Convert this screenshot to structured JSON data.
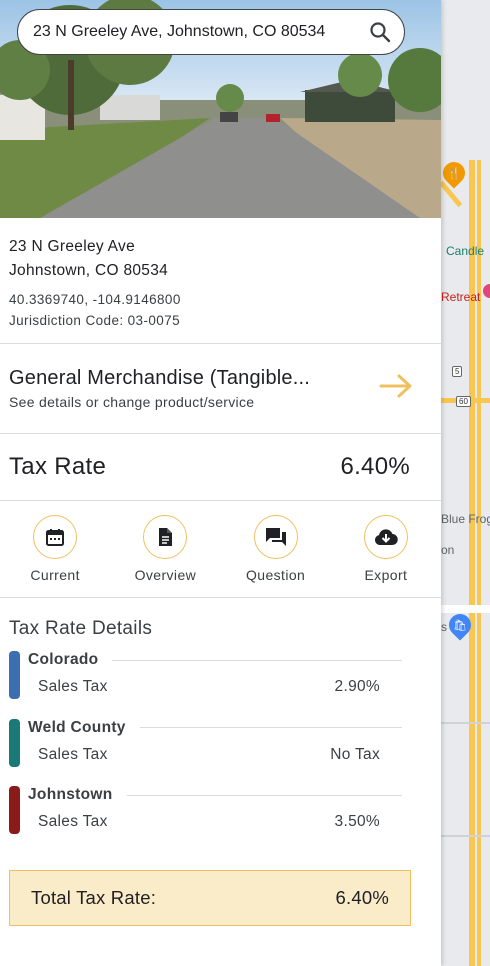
{
  "search": {
    "value": "23 N Greeley Ave, Johnstown, CO 80534",
    "icon": "search-icon"
  },
  "location": {
    "street": "23 N Greeley Ave",
    "city_line": "Johnstown, CO 80534",
    "coordinates": "40.3369740, -104.9146800",
    "jurisdiction": "Jurisdiction Code: 03-0075"
  },
  "product": {
    "title": "General Merchandise (Tangible...",
    "subtitle": "See details or change product/service",
    "icon": "arrow-right-icon"
  },
  "rate": {
    "label": "Tax Rate",
    "value": "6.40%"
  },
  "actions": [
    {
      "label": "Current",
      "icon": "calendar-icon"
    },
    {
      "label": "Overview",
      "icon": "document-icon"
    },
    {
      "label": "Question",
      "icon": "chat-icon"
    },
    {
      "label": "Export",
      "icon": "cloud-download-icon"
    }
  ],
  "details": {
    "title": "Tax Rate Details",
    "jurisdictions": [
      {
        "name": "Colorado",
        "tax": "Sales Tax",
        "value": "2.90%",
        "color": "#3b6fb0"
      },
      {
        "name": "Weld County",
        "tax": "Sales Tax",
        "value": "No Tax",
        "color": "#1b7a78"
      },
      {
        "name": "Johnstown",
        "tax": "Sales Tax",
        "value": "3.50%",
        "color": "#8b1a1a"
      }
    ]
  },
  "total": {
    "label": "Total Tax Rate:",
    "value": "6.40%"
  },
  "map": {
    "labels": [
      "Candle",
      "Retreat",
      "Blue Frog",
      "on",
      "s"
    ],
    "shields": [
      "5",
      "60"
    ]
  },
  "colors": {
    "accent": "#f0c060",
    "total_bg": "#fbecc9"
  }
}
